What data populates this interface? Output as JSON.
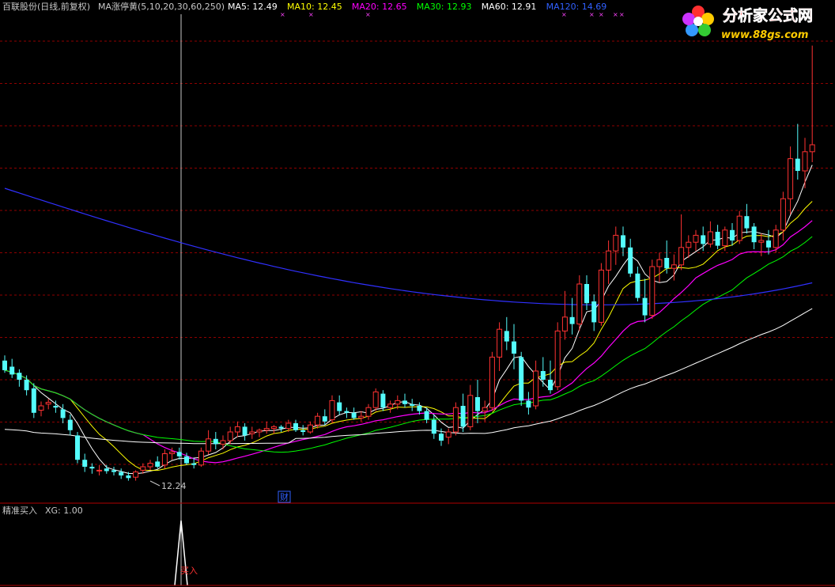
{
  "header": {
    "stock": "百联股份(日线,前复权)",
    "indicator": "MA涨停黄(5,10,20,30,60,250)",
    "ma": [
      {
        "label": "MA5: 12.49",
        "color": "#ffffff"
      },
      {
        "label": "MA10: 12.45",
        "color": "#ffff00"
      },
      {
        "label": "MA20: 12.65",
        "color": "#ff00ff"
      },
      {
        "label": "MA30: 12.93",
        "color": "#00ff00"
      },
      {
        "label": "MA60: 12.91",
        "color": "#ffffff"
      },
      {
        "label": "MA120: 14.69",
        "color": "#3060ff"
      }
    ]
  },
  "logo": {
    "title": "分析家公式网",
    "url": "www.88gs.com"
  },
  "lower_panel": {
    "name": "精准买入",
    "xg": "XG: 1.00",
    "signal_label": "买入"
  },
  "annotations": {
    "low_marker": "12.24",
    "fin_marker": "财"
  },
  "colors": {
    "up": "#ff3232",
    "down": "#54fcfc",
    "grid": "#900000",
    "frame": "#b00000",
    "ma5": "#ffffff",
    "ma10": "#ffff00",
    "ma20": "#ff00ff",
    "ma30": "#00ff00",
    "ma60": "#ffffff",
    "ma120": "#3030ff"
  },
  "chart_data": {
    "type": "candlestick",
    "ylim": [
      12.0,
      17.6
    ],
    "candles": [
      [
        13.62,
        13.68,
        13.48,
        13.51
      ],
      [
        13.55,
        13.64,
        13.42,
        13.46
      ],
      [
        13.48,
        13.52,
        13.32,
        13.4
      ],
      [
        13.4,
        13.45,
        13.22,
        13.28
      ],
      [
        13.3,
        13.36,
        12.96,
        13.02
      ],
      [
        13.05,
        13.15,
        12.98,
        13.1
      ],
      [
        13.12,
        13.18,
        13.06,
        13.14
      ],
      [
        13.1,
        13.16,
        13.02,
        13.08
      ],
      [
        13.06,
        13.12,
        12.9,
        12.96
      ],
      [
        12.94,
        13.0,
        12.76,
        12.82
      ],
      [
        12.76,
        12.8,
        12.44,
        12.48
      ],
      [
        12.48,
        12.55,
        12.34,
        12.4
      ],
      [
        12.4,
        12.44,
        12.32,
        12.38
      ],
      [
        12.36,
        12.42,
        12.3,
        12.36
      ],
      [
        12.38,
        12.42,
        12.32,
        12.35
      ],
      [
        12.36,
        12.4,
        12.3,
        12.34
      ],
      [
        12.34,
        12.38,
        12.26,
        12.3
      ],
      [
        12.3,
        12.34,
        12.24,
        12.27
      ],
      [
        12.28,
        12.36,
        12.24,
        12.34
      ],
      [
        12.36,
        12.44,
        12.32,
        12.4
      ],
      [
        12.4,
        12.48,
        12.36,
        12.44
      ],
      [
        12.46,
        12.52,
        12.38,
        12.4
      ],
      [
        12.42,
        12.6,
        12.38,
        12.55
      ],
      [
        12.55,
        12.62,
        12.48,
        12.57
      ],
      [
        12.57,
        12.62,
        12.48,
        12.52
      ],
      [
        12.52,
        12.56,
        12.42,
        12.44
      ],
      [
        12.44,
        12.5,
        12.38,
        12.42
      ],
      [
        12.42,
        12.62,
        12.4,
        12.58
      ],
      [
        12.58,
        12.82,
        12.54,
        12.72
      ],
      [
        12.72,
        12.8,
        12.6,
        12.66
      ],
      [
        12.66,
        12.76,
        12.6,
        12.7
      ],
      [
        12.7,
        12.86,
        12.66,
        12.8
      ],
      [
        12.8,
        12.92,
        12.74,
        12.86
      ],
      [
        12.86,
        12.9,
        12.7,
        12.76
      ],
      [
        12.78,
        12.86,
        12.72,
        12.8
      ],
      [
        12.8,
        12.84,
        12.74,
        12.82
      ],
      [
        12.82,
        12.92,
        12.78,
        12.84
      ],
      [
        12.84,
        12.88,
        12.78,
        12.86
      ],
      [
        12.86,
        12.88,
        12.8,
        12.84
      ],
      [
        12.84,
        12.94,
        12.8,
        12.9
      ],
      [
        12.9,
        12.94,
        12.8,
        12.82
      ],
      [
        12.82,
        12.88,
        12.76,
        12.8
      ],
      [
        12.8,
        12.92,
        12.78,
        12.88
      ],
      [
        12.88,
        13.02,
        12.84,
        12.98
      ],
      [
        12.98,
        13.06,
        12.88,
        12.92
      ],
      [
        12.94,
        13.22,
        12.9,
        13.16
      ],
      [
        13.14,
        13.22,
        13.0,
        13.04
      ],
      [
        13.04,
        13.08,
        12.96,
        13.02
      ],
      [
        13.02,
        13.08,
        12.94,
        12.96
      ],
      [
        12.96,
        13.04,
        12.92,
        12.98
      ],
      [
        12.98,
        13.12,
        12.94,
        13.08
      ],
      [
        13.08,
        13.3,
        13.04,
        13.26
      ],
      [
        13.24,
        13.28,
        13.04,
        13.08
      ],
      [
        13.08,
        13.16,
        13.02,
        13.12
      ],
      [
        13.12,
        13.22,
        13.06,
        13.16
      ],
      [
        13.16,
        13.24,
        13.08,
        13.12
      ],
      [
        13.12,
        13.18,
        13.04,
        13.1
      ],
      [
        13.1,
        13.14,
        13.0,
        13.04
      ],
      [
        13.04,
        13.08,
        12.9,
        12.94
      ],
      [
        12.94,
        13.0,
        12.72,
        12.78
      ],
      [
        12.78,
        12.84,
        12.64,
        12.7
      ],
      [
        12.74,
        12.84,
        12.66,
        12.8
      ],
      [
        12.8,
        13.14,
        12.76,
        13.08
      ],
      [
        13.1,
        13.24,
        12.8,
        12.86
      ],
      [
        12.86,
        13.34,
        12.82,
        13.22
      ],
      [
        13.2,
        13.4,
        12.9,
        13.04
      ],
      [
        13.04,
        13.16,
        12.92,
        13.08
      ],
      [
        13.08,
        13.72,
        13.04,
        13.66
      ],
      [
        13.66,
        14.06,
        13.5,
        13.98
      ],
      [
        13.96,
        14.12,
        13.74,
        13.84
      ],
      [
        13.84,
        14.04,
        13.52,
        13.7
      ],
      [
        13.66,
        13.72,
        13.1,
        13.16
      ],
      [
        13.16,
        13.26,
        13.0,
        13.08
      ],
      [
        13.1,
        13.62,
        13.06,
        13.5
      ],
      [
        13.5,
        13.66,
        13.32,
        13.4
      ],
      [
        13.4,
        13.62,
        13.24,
        13.28
      ],
      [
        13.32,
        14.06,
        13.28,
        13.96
      ],
      [
        13.96,
        14.42,
        13.86,
        14.12
      ],
      [
        14.12,
        14.34,
        13.92,
        14.04
      ],
      [
        14.04,
        14.6,
        13.96,
        14.5
      ],
      [
        14.5,
        14.6,
        14.2,
        14.28
      ],
      [
        14.3,
        14.38,
        13.96,
        14.06
      ],
      [
        14.06,
        14.74,
        14.02,
        14.66
      ],
      [
        14.66,
        15.0,
        14.5,
        14.88
      ],
      [
        14.88,
        15.16,
        14.72,
        15.06
      ],
      [
        15.06,
        15.16,
        14.82,
        14.92
      ],
      [
        14.92,
        15.02,
        14.58,
        14.62
      ],
      [
        14.62,
        14.7,
        14.3,
        14.34
      ],
      [
        14.34,
        14.56,
        14.06,
        14.14
      ],
      [
        14.14,
        14.78,
        14.1,
        14.7
      ],
      [
        14.7,
        14.86,
        14.52,
        14.78
      ],
      [
        14.8,
        15.0,
        14.62,
        14.68
      ],
      [
        14.68,
        14.84,
        14.54,
        14.72
      ],
      [
        14.72,
        15.3,
        14.66,
        14.92
      ],
      [
        14.92,
        15.06,
        14.8,
        14.98
      ],
      [
        14.98,
        15.12,
        14.88,
        15.06
      ],
      [
        15.06,
        15.16,
        14.88,
        14.96
      ],
      [
        14.96,
        15.22,
        14.92,
        15.1
      ],
      [
        15.1,
        15.18,
        14.9,
        14.94
      ],
      [
        14.94,
        15.16,
        14.88,
        15.12
      ],
      [
        15.12,
        15.2,
        14.94,
        15.0
      ],
      [
        15.0,
        15.34,
        14.96,
        15.28
      ],
      [
        15.28,
        15.42,
        15.08,
        15.14
      ],
      [
        15.16,
        15.2,
        14.9,
        14.98
      ],
      [
        14.98,
        15.08,
        14.82,
        15.0
      ],
      [
        15.0,
        15.12,
        14.84,
        14.92
      ],
      [
        14.92,
        15.18,
        14.86,
        15.12
      ],
      [
        15.12,
        15.56,
        15.0,
        15.48
      ],
      [
        15.48,
        16.08,
        15.3,
        15.94
      ],
      [
        15.94,
        16.34,
        15.7,
        15.8
      ],
      [
        15.8,
        16.18,
        15.6,
        16.02
      ],
      [
        16.02,
        17.24,
        15.9,
        16.1
      ]
    ]
  }
}
